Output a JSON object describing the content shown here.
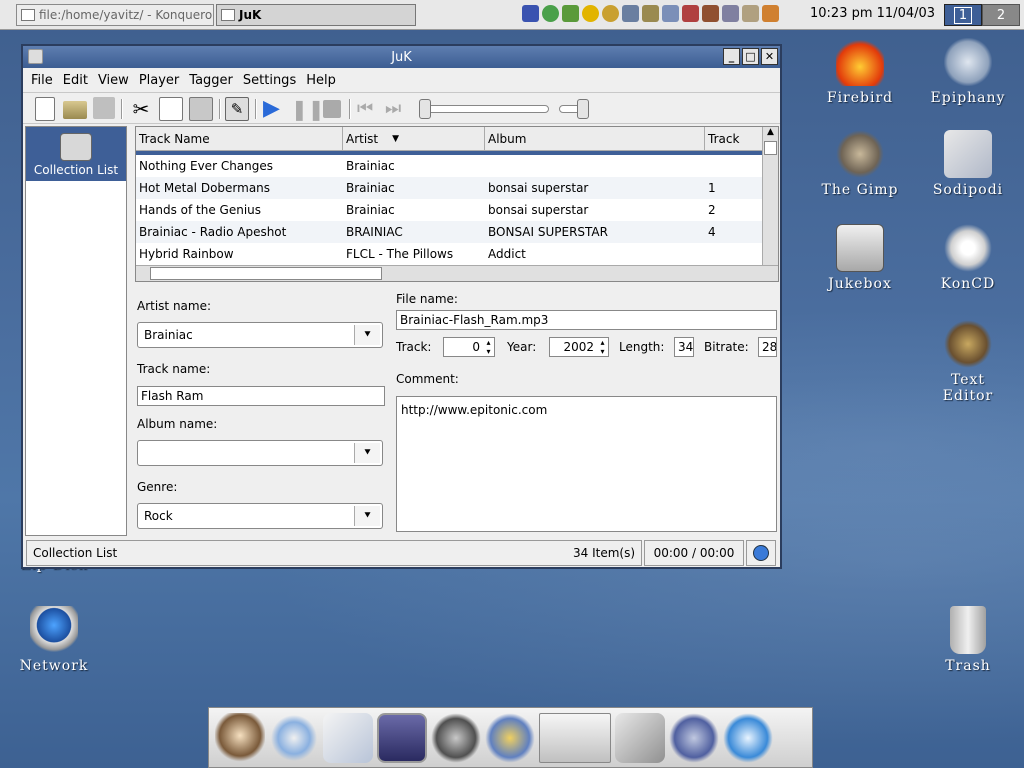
{
  "taskbar": {
    "tasks": [
      {
        "label": "file:/home/yavitz/ - Konqueror",
        "active": false
      },
      {
        "label": "JuK",
        "active": true
      }
    ],
    "clock": "10:23 pm 11/04/03",
    "desktops": [
      "1",
      "2"
    ],
    "active_desktop": "1"
  },
  "desktop_icons": [
    {
      "label": "Firebird",
      "icon": "firebird-icon"
    },
    {
      "label": "Epiphany",
      "icon": "epiphany-icon"
    },
    {
      "label": "The Gimp",
      "icon": "gimp-icon"
    },
    {
      "label": "Sodipodi",
      "icon": "sodipodi-icon"
    },
    {
      "label": "Jukebox",
      "icon": "jukebox-icon"
    },
    {
      "label": "KonCD",
      "icon": "koncd-icon"
    },
    {
      "label": "Text Editor",
      "label_line1": "Text",
      "label_line2": "Editor",
      "icon": "text-editor-icon"
    },
    {
      "label": "Network",
      "icon": "network-icon"
    },
    {
      "label": "Trash",
      "icon": "trash-icon"
    },
    {
      "label": "Zip Disk",
      "icon": "zip-disk-icon"
    }
  ],
  "window": {
    "title": "JuK",
    "menu": [
      "File",
      "Edit",
      "View",
      "Player",
      "Tagger",
      "Settings",
      "Help"
    ],
    "sidebar": {
      "selected": "Collection List"
    },
    "list": {
      "columns": [
        "Track Name",
        "Artist",
        "Album",
        "Track"
      ],
      "sorted_column": "Artist",
      "rows": [
        {
          "name": "Nothing Ever Changes",
          "artist": "Brainiac",
          "album": "",
          "track": ""
        },
        {
          "name": "Hot Metal Dobermans",
          "artist": "Brainiac",
          "album": "bonsai superstar",
          "track": "1"
        },
        {
          "name": "Hands of the Genius",
          "artist": "Brainiac",
          "album": "bonsai superstar",
          "track": "2"
        },
        {
          "name": "Brainiac - Radio Apeshot",
          "artist": "BRAINIAC",
          "album": "BONSAI SUPERSTAR",
          "track": "4"
        },
        {
          "name": "Hybrid Rainbow",
          "artist": "FLCL - The Pillows",
          "album": "Addict",
          "track": ""
        }
      ]
    },
    "editor": {
      "artist_label": "Artist name:",
      "artist_value": "Brainiac",
      "track_label": "Track name:",
      "track_value": "Flash Ram",
      "album_label": "Album name:",
      "album_value": "",
      "genre_label": "Genre:",
      "genre_value": "Rock",
      "file_label": "File name:",
      "file_value": "Brainiac-Flash_Ram.mp3",
      "tracknum_label": "Track:",
      "tracknum_value": "0",
      "year_label": "Year:",
      "year_value": "2002",
      "length_label": "Length:",
      "length_value": "34",
      "bitrate_label": "Bitrate:",
      "bitrate_value": "28",
      "comment_label": "Comment:",
      "comment_value": "http://www.epitonic.com"
    },
    "status": {
      "playlist": "Collection List",
      "items": "34 Item(s)",
      "time": "00:00 / 00:00"
    }
  },
  "colors": {
    "desktop": "#4a6d9e",
    "titlebar": "#4a6aa0",
    "selection": "#3e5f97"
  },
  "dock_icons": [
    "gnome-foot-monkey-icon",
    "search-icon",
    "mail-icon",
    "terminal-icon",
    "settings-tools-icon",
    "paint-icon",
    "clipboard-icon",
    "volume-icon",
    "windows-icon",
    "gnome-foot-icon",
    "x-icon"
  ]
}
